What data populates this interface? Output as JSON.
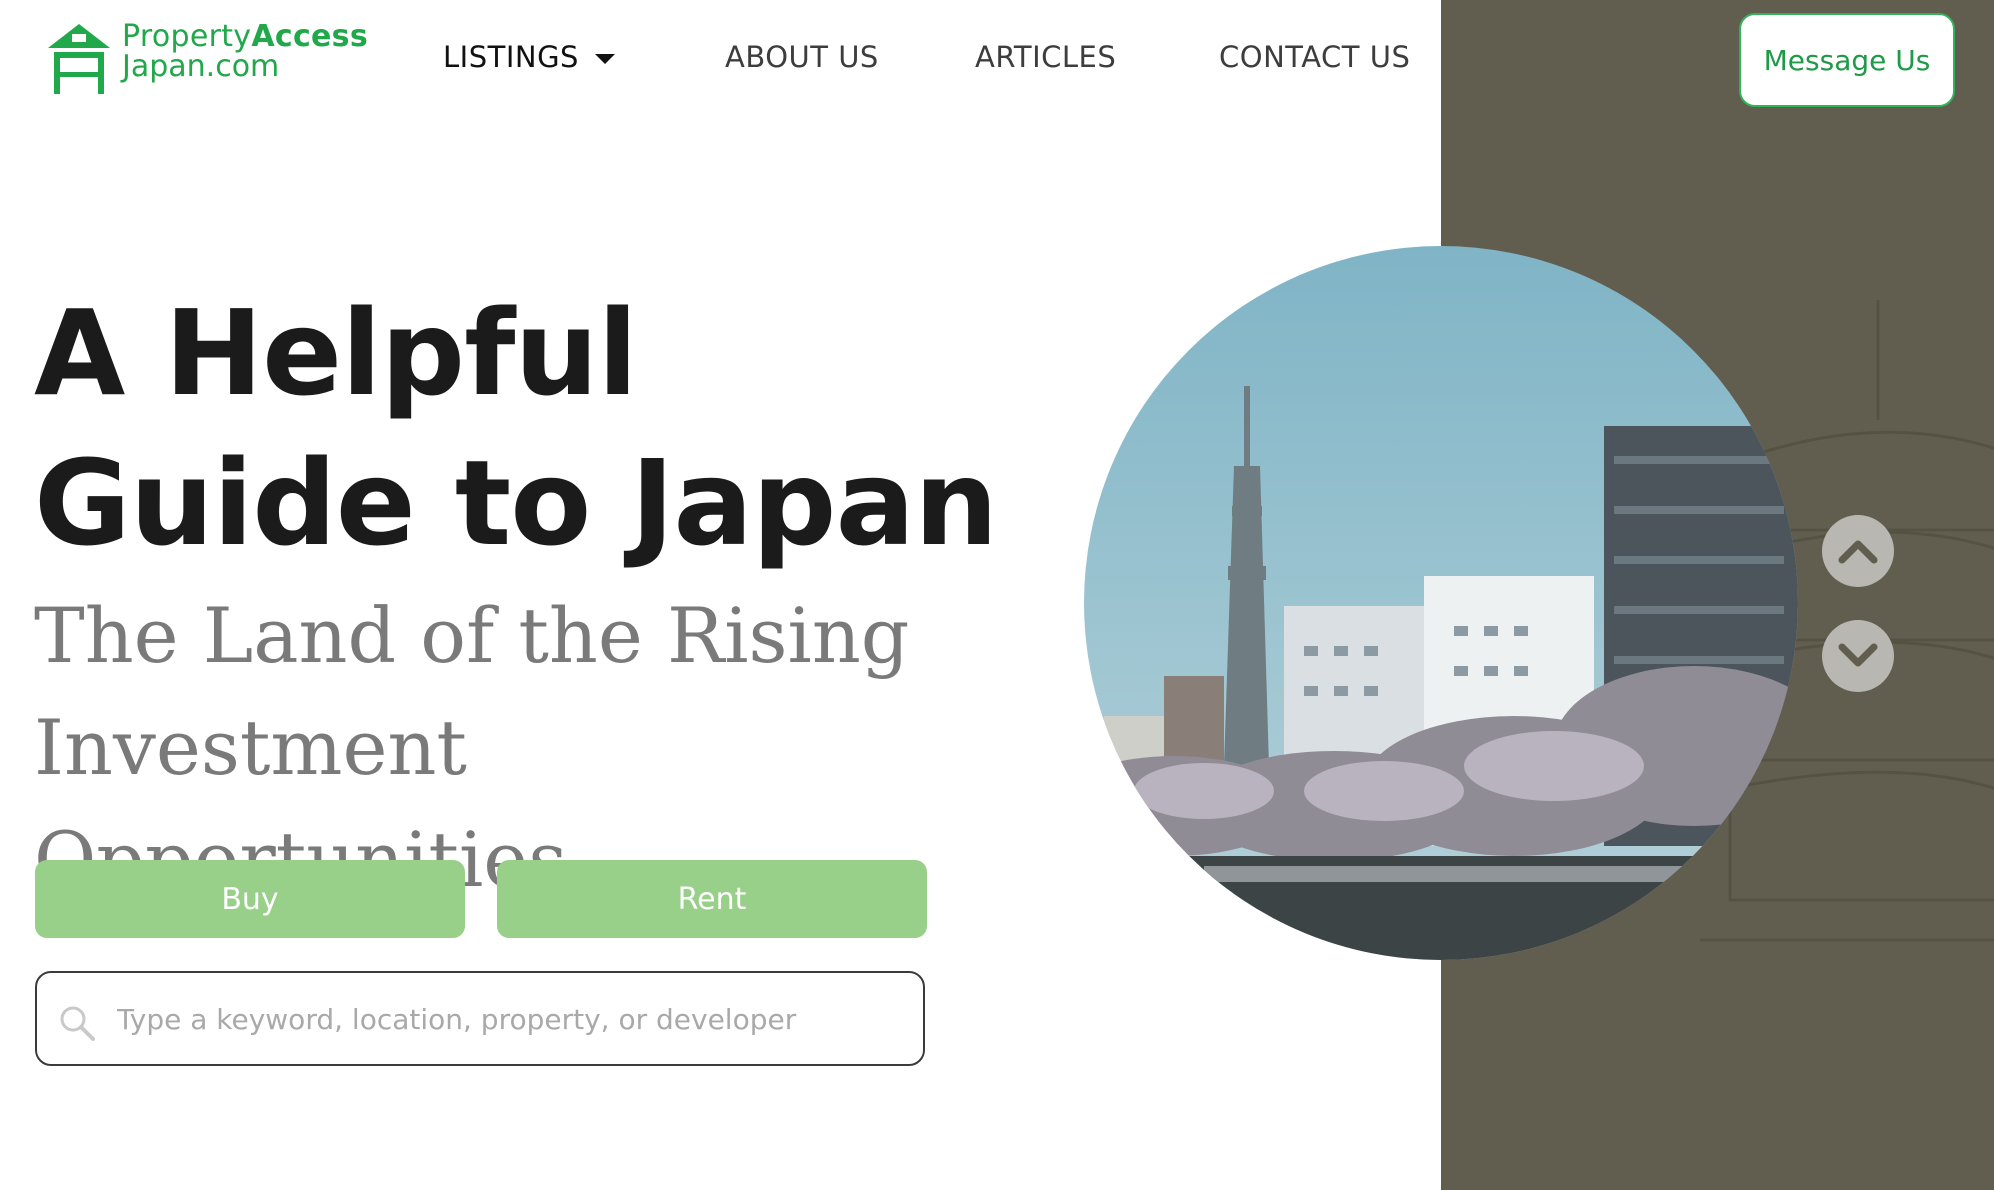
{
  "logo": {
    "line1_a": "Property",
    "line1_b": "Access",
    "line2": "Japan.com",
    "icon": "house-gate-icon",
    "color": "#20a84a"
  },
  "nav": {
    "listings": "LISTINGS",
    "about": "ABOUT US",
    "articles": "ARTICLES",
    "contact": "CONTACT US"
  },
  "header": {
    "message_button": "Message Us"
  },
  "hero": {
    "title_line1": "A Helpful",
    "title_line2": "Guide to Japan",
    "subtitle_line1": "The Land of the Rising",
    "subtitle_line2": "Investment Opportunities"
  },
  "actions": {
    "buy": "Buy",
    "rent": "Rent"
  },
  "search": {
    "placeholder": "Type a keyword, location, property, or developer",
    "value": "",
    "icon": "search-icon"
  },
  "carousel": {
    "up_icon": "chevron-up-icon",
    "down_icon": "chevron-down-icon",
    "image_subject": "tokyo-skytree-cityscape-photo"
  },
  "colors": {
    "brand_green": "#20a84a",
    "button_green": "#98cf89",
    "side_panel": "#625e4f",
    "title": "#1c1b1c",
    "subtitle": "#7a7a7a"
  }
}
